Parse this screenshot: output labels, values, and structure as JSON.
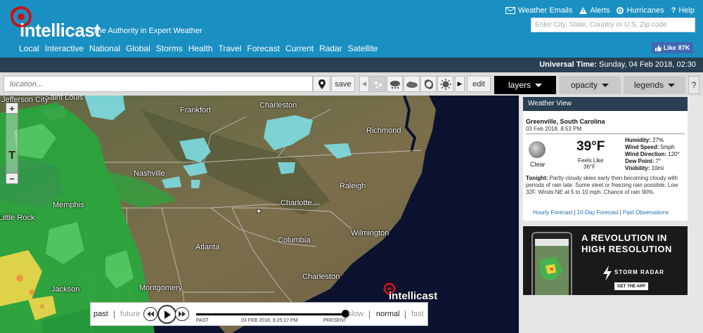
{
  "header": {
    "brand": "intellicast",
    "tagline": "The Authority in Expert Weather",
    "links": [
      {
        "label": "Weather Emails",
        "icon": "mail-icon"
      },
      {
        "label": "Alerts",
        "icon": "alert-triangle-icon"
      },
      {
        "label": "Hurricanes",
        "icon": "hurricane-icon"
      },
      {
        "label": "Help",
        "icon": "help-icon"
      }
    ],
    "search_placeholder": "Enter City, State, Country or U.S. Zip code",
    "nav": [
      "Local",
      "Interactive",
      "National",
      "Global",
      "Storms",
      "Health",
      "Travel",
      "Forecast",
      "Current",
      "Radar",
      "Satellite"
    ],
    "like_label": "Like",
    "like_count": "87K",
    "colors": {
      "header_bg": "#1a8fc2",
      "nav_text": "#ffffff",
      "like_bg": "#4267b2"
    }
  },
  "utc": {
    "label": "Universal Time:",
    "value": "Sunday, 04 Feb 2018, 02:30"
  },
  "toolbar": {
    "location_placeholder": "location...",
    "save_label": "save",
    "edit_label": "edit",
    "layers_label": "layers",
    "opacity_label": "opacity",
    "legends_label": "legends",
    "help_label": "?",
    "layer_icons": [
      "precip-icon",
      "storm-cloud-icon",
      "cloud-icon",
      "hurricane-layer-icon",
      "sun-icon"
    ]
  },
  "map": {
    "cities": [
      "Saint Louis",
      "Frankfort",
      "Charleston",
      "Richmond",
      "Nashville",
      "Raleigh",
      "Memphis",
      "Little Rock",
      "Charlotte",
      "Wilmington",
      "Columbia",
      "Atlanta",
      "Charleston",
      "Montgomery",
      "Jackson",
      "Jefferson City"
    ],
    "watermark": "intellicast",
    "zoom_in": "+",
    "zoom_out": "−"
  },
  "timeline": {
    "past": "past",
    "future": "future",
    "start_label": "PAST",
    "current_time": "03 FEB 2018, 9:25:17 PM",
    "end_label": "PRESENT",
    "slow": "slow",
    "normal": "normal",
    "fast": "fast",
    "separator": "|",
    "position": 1.0
  },
  "weather_view": {
    "title": "Weather View",
    "city": "Greenville, South Carolina",
    "date": "03 Feb 2018, 8:53 PM",
    "condition": "Clear",
    "temp": "39°F",
    "feels_label": "Feels Like",
    "feels_value": "36°F",
    "stats": [
      {
        "label": "Humidity:",
        "value": "27%"
      },
      {
        "label": "Wind Speed:",
        "value": "5mph"
      },
      {
        "label": "Wind Direction:",
        "value": "120°"
      },
      {
        "label": "Dew Point:",
        "value": "7°"
      },
      {
        "label": "Visibility:",
        "value": "10mi"
      }
    ],
    "tonight_label": "Tonight:",
    "tonight_text": "Partly cloudy skies early then becoming cloudy with periods of rain late. Some sleet or freezing rain possible. Low 32F. Winds NE at 5 to 10 mph. Chance of rain 90%.",
    "links": [
      "Hourly Forecast",
      "10-Day Forecast",
      "Past Observations"
    ]
  },
  "ad": {
    "headline1": "A REVOLUTION IN",
    "headline2": "HIGH RESOLUTION",
    "brand": "STORM RADAR",
    "cta": "GET THE APP"
  }
}
